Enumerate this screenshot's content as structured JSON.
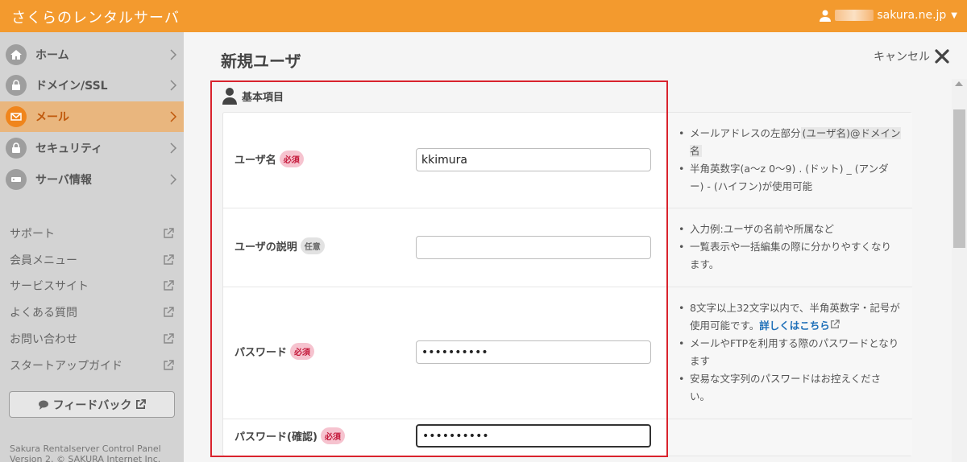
{
  "header": {
    "brand": "さくらのレンタルサーバ",
    "account_domain": "sakura.ne.jp"
  },
  "sidebar": {
    "nav": [
      {
        "label": "ホーム",
        "icon": "home-icon",
        "active": false
      },
      {
        "label": "ドメイン/SSL",
        "icon": "domain-icon",
        "active": false
      },
      {
        "label": "メール",
        "icon": "mail-icon",
        "active": true
      },
      {
        "label": "セキュリティ",
        "icon": "lock-icon",
        "active": false
      },
      {
        "label": "サーバ情報",
        "icon": "server-icon",
        "active": false
      }
    ],
    "links": [
      "サポート",
      "会員メニュー",
      "サービスサイト",
      "よくある質問",
      "お問い合わせ",
      "スタートアップガイド"
    ],
    "feedback_label": "フィードバック",
    "copyright_line1": "Sakura Rentalserver Control Panel",
    "copyright_line2": "Version 2. © SAKURA Internet Inc."
  },
  "main": {
    "title": "新規ユーザ",
    "cancel_label": "キャンセル",
    "section_title": "基本項目",
    "badges": {
      "required": "必須",
      "optional": "任意"
    },
    "fields": {
      "username": {
        "label": "ユーザ名",
        "value": "kkimura"
      },
      "description": {
        "label": "ユーザの説明",
        "value": ""
      },
      "password": {
        "label": "パスワード",
        "value": "••••••••••"
      },
      "password_confirm": {
        "label": "パスワード(確認)",
        "value": "••••••••••"
      }
    },
    "help": {
      "username_1_a": "メールアドレスの左部分",
      "username_1_code": "(ユーザ名)@ドメイン名",
      "username_2": "半角英数字(a〜z 0〜9) . (ドット) _ (アンダー) - (ハイフン)が使用可能",
      "description_1": "入力例:ユーザの名前や所属など",
      "description_2": "一覧表示や一括編集の際に分かりやすくなります。",
      "password_1": "8文字以上32文字以内で、半角英数字・記号が使用可能です。",
      "password_1_link": "詳しくはこちら",
      "password_2": "メールやFTPを利用する際のパスワードとなります",
      "password_3": "安易な文字列のパスワードはお控えください。"
    }
  }
}
